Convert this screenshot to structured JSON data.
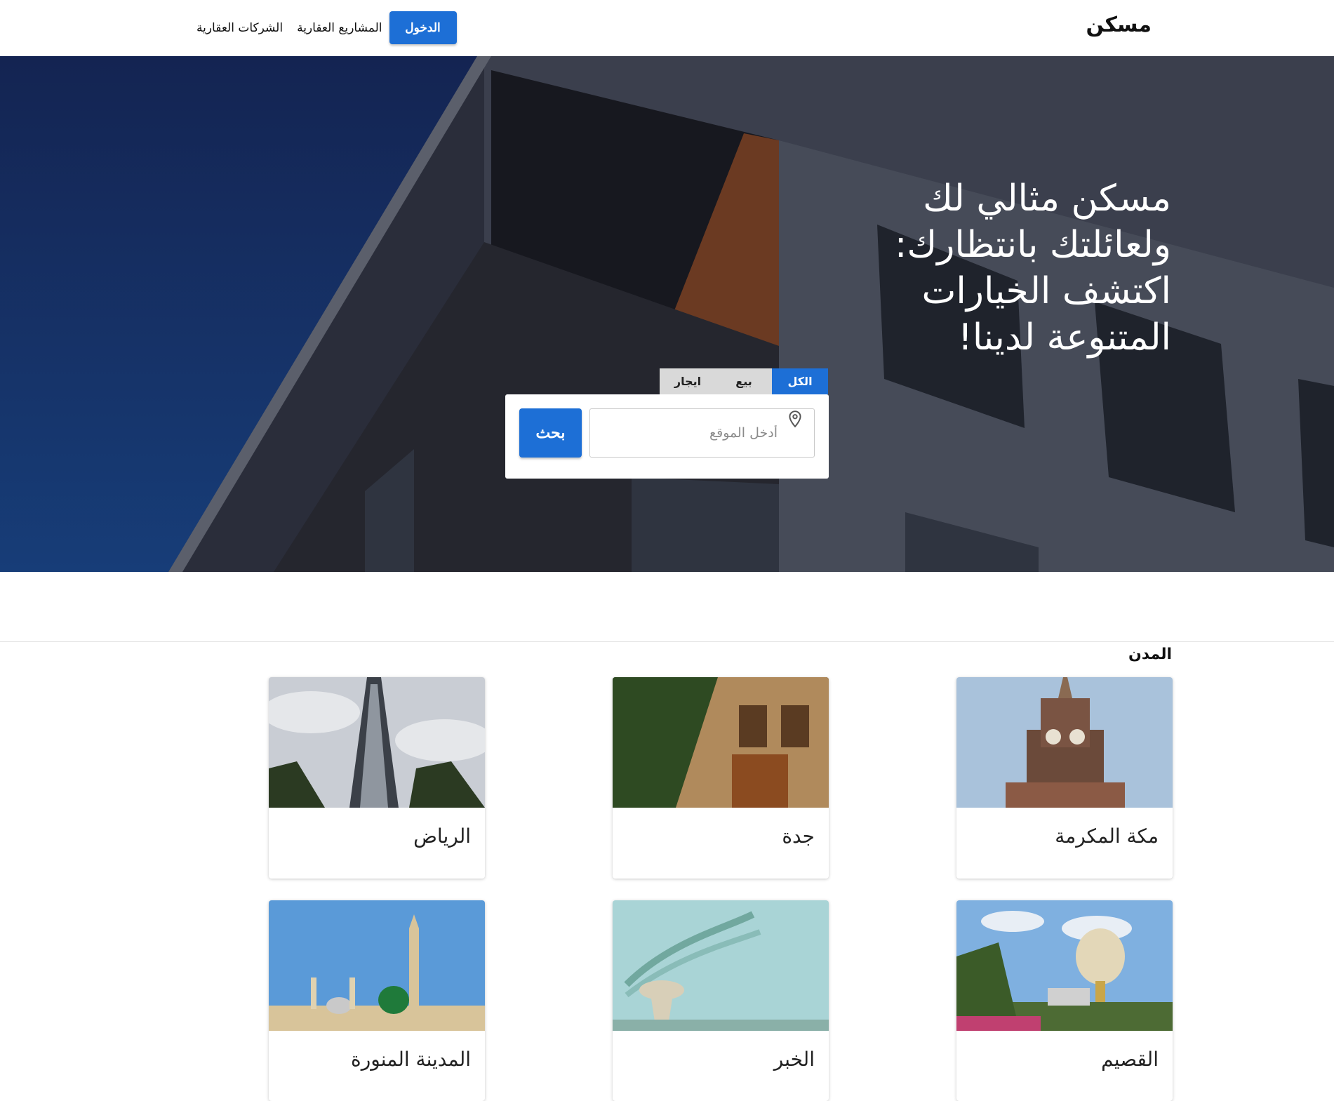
{
  "navbar": {
    "brand": "مسكن",
    "links": [
      "الشركات العقارية",
      "المشاريع العقارية"
    ],
    "login_label": "الدخول"
  },
  "hero": {
    "title": "مسكن مثالي لك ولعائلتك بانتظارك: اكتشف الخيارات المتنوعة لدينا!",
    "tabs": [
      {
        "label": "الكل",
        "active": true
      },
      {
        "label": "بيع",
        "active": false
      },
      {
        "label": "ايجار",
        "active": false
      }
    ],
    "search_placeholder": "أدخل الموقع",
    "search_button": "بحث",
    "pin_icon": "map-pin-icon"
  },
  "cities": {
    "title": "المدن",
    "items": [
      {
        "name": "مكة المكرمة",
        "image": "clock-tower-image"
      },
      {
        "name": "جدة",
        "image": "historic-building-image"
      },
      {
        "name": "الرياض",
        "image": "faisaliah-tower-image"
      },
      {
        "name": "القصيم",
        "image": "water-tower-park-image"
      },
      {
        "name": "الخبر",
        "image": "water-tower-airshow-image"
      },
      {
        "name": "المدينة المنورة",
        "image": "prophets-mosque-image"
      }
    ]
  },
  "colors": {
    "accent": "#1d6fd6",
    "hero_sky": "#152f5e"
  }
}
